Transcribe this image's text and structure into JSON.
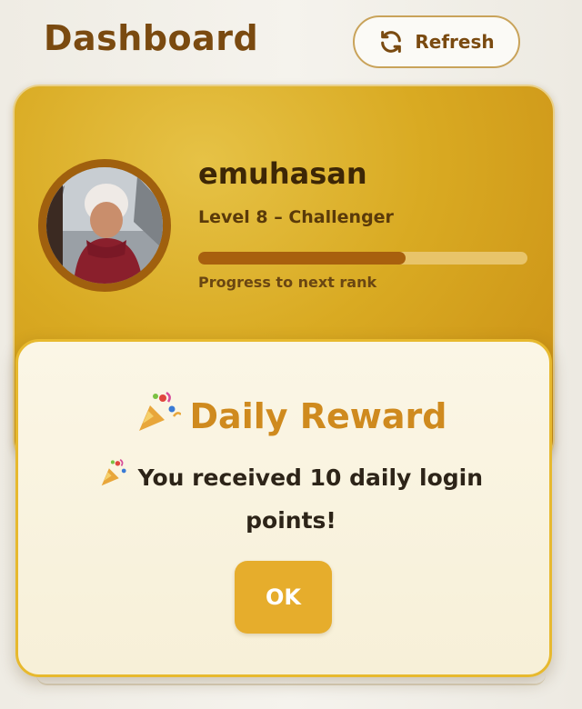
{
  "header": {
    "title": "Dashboard",
    "refresh_label": "Refresh"
  },
  "profile": {
    "username": "emuhasan",
    "level_text": "Level 8 – Challenger",
    "progress_fraction": 0.63,
    "progress_label": "Progress to next rank"
  },
  "modal": {
    "title": "Daily Reward",
    "message_line1": "You received 10 daily login",
    "message_line2": "points!",
    "ok_label": "OK"
  },
  "colors": {
    "brand_brown": "#7a4a10",
    "card_gold": "#d9aa22",
    "reward_orange": "#cf8a1e",
    "ok_button": "#e6ad2c"
  },
  "icons": {
    "refresh": "refresh-icon",
    "party": "party-popper-icon"
  }
}
